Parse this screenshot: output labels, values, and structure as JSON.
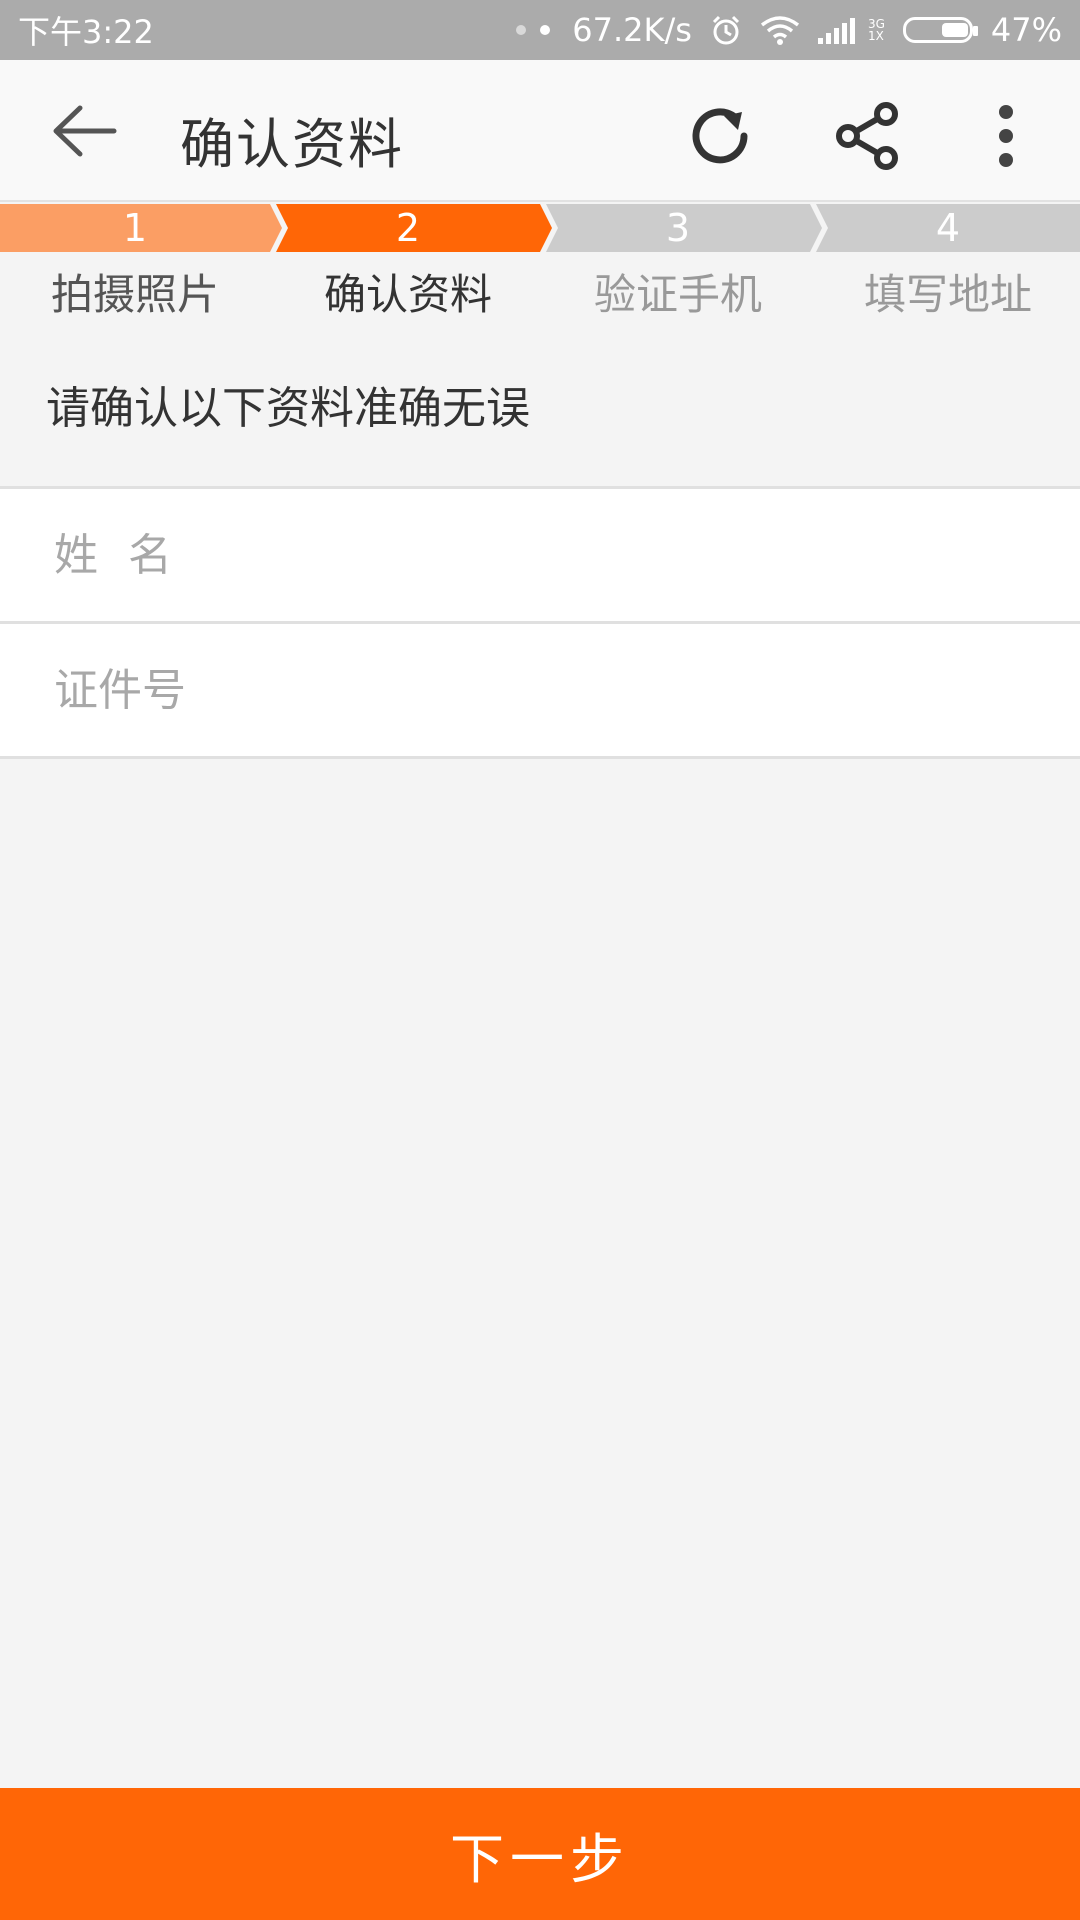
{
  "status_bar": {
    "time": "下午3:22",
    "net_speed": "67.2K/s",
    "network_type_top": "3G",
    "network_type_bottom": "1X",
    "battery": "47%",
    "battery_level": 0.47,
    "icons": [
      "alarm-icon",
      "wifi-icon",
      "signal-icon",
      "battery-icon"
    ]
  },
  "app_bar": {
    "title": "确认资料",
    "icons": [
      "back-arrow-icon",
      "refresh-icon",
      "share-icon",
      "more-vertical-icon"
    ]
  },
  "steps": {
    "current": 2,
    "items": [
      {
        "number": "1",
        "label": "拍摄照片",
        "state": "done"
      },
      {
        "number": "2",
        "label": "确认资料",
        "state": "active"
      },
      {
        "number": "3",
        "label": "验证手机",
        "state": "pending"
      },
      {
        "number": "4",
        "label": "填写地址",
        "state": "pending"
      }
    ],
    "colors": {
      "done": "#fb9e64",
      "active": "#ff6606",
      "pending": "#cccccc"
    }
  },
  "prompt": "请确认以下资料准确无误",
  "form": {
    "name": {
      "placeholder": "姓名",
      "value": ""
    },
    "id_number": {
      "placeholder": "证件号",
      "value": ""
    }
  },
  "next_button": {
    "label": "下一步",
    "color": "#ff6606"
  }
}
